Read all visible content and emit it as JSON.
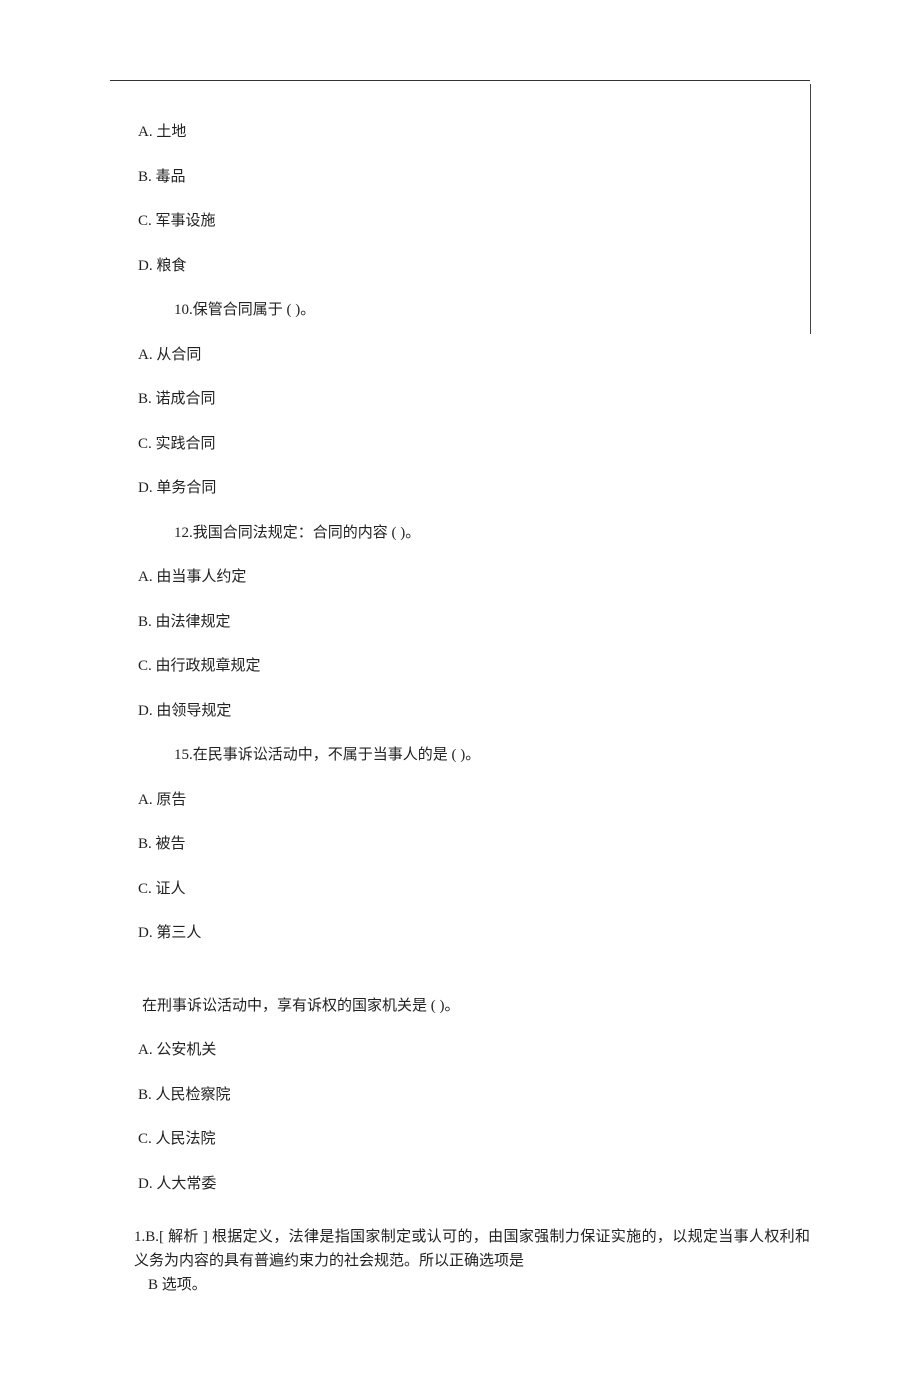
{
  "q9": {
    "options": {
      "a": "A. 土地",
      "b": "B. 毒品",
      "c": "C. 军事设施",
      "d": "D. 粮食"
    }
  },
  "q10": {
    "stem": "10.保管合同属于  ( )。",
    "options": {
      "a": "A. 从合同",
      "b": "B. 诺成合同",
      "c": "C. 实践合同",
      "d": "D. 单务合同"
    }
  },
  "q12": {
    "stem": "12.我国合同法规定：合同的内容     ( )。",
    "options": {
      "a": "A. 由当事人约定",
      "b": "B. 由法律规定",
      "c": "C. 由行政规章规定",
      "d": "D. 由领导规定"
    }
  },
  "q15": {
    "stem": "15.在民事诉讼活动中，不属于当事人的是       ( )。",
    "options": {
      "a": "A. 原告",
      "b": "B. 被告",
      "c": "C. 证人",
      "d": "D. 第三人"
    }
  },
  "qExtra": {
    "stem": "在刑事诉讼活动中，享有诉权的国家机关是       ( )。",
    "options": {
      "a": "A. 公安机关",
      "b": "B. 人民检察院",
      "c": "C. 人民法院",
      "d": "D. 人大常委"
    }
  },
  "answer1": {
    "prefix": "1.B.[ 解析 ] 根据定义，法律是指国家制定或认可的，由国家强制力保证实施的，以规定当事人权利和义务为内容的具有普遍约束力的社会规范。所以正确选项是",
    "suffix": "B 选项。"
  }
}
